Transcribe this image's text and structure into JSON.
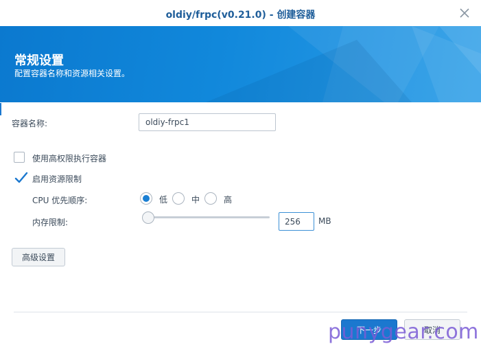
{
  "window": {
    "title": "oldiy/frpc(v0.21.0) - 创建容器"
  },
  "banner": {
    "title": "常规设置",
    "subtitle": "配置容器名称和资源相关设置。"
  },
  "form": {
    "container_name_label": "容器名称:",
    "container_name_value": "oldiy-frpc1",
    "privileged_label": "使用高权限执行容器",
    "privileged_checked": false,
    "resource_limit_label": "启用资源限制",
    "resource_limit_checked": true,
    "cpu_priority_label": "CPU 优先顺序:",
    "cpu_options": [
      "低",
      "中",
      "高"
    ],
    "cpu_selected": "低",
    "memory_limit_label": "内存限制:",
    "memory_value": "256",
    "memory_unit": "MB",
    "memory_slider_fraction": 0
  },
  "buttons": {
    "advanced": "高级设置",
    "next": "下一步",
    "cancel": "取消"
  },
  "watermark": "punygear.com",
  "colors": {
    "accent": "#1b78cf",
    "banner": "#1188db",
    "title": "#1f5e9a"
  }
}
